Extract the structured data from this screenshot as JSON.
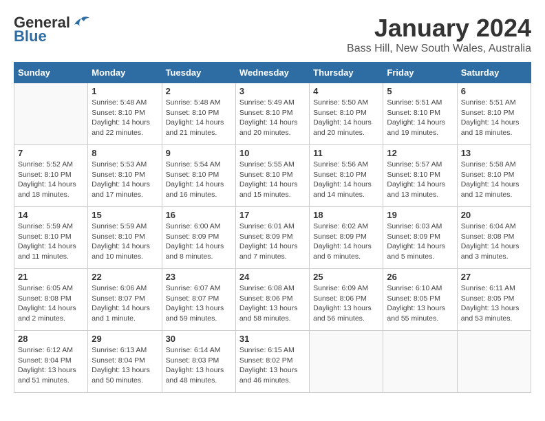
{
  "logo": {
    "general": "General",
    "blue": "Blue"
  },
  "title": "January 2024",
  "location": "Bass Hill, New South Wales, Australia",
  "days_of_week": [
    "Sunday",
    "Monday",
    "Tuesday",
    "Wednesday",
    "Thursday",
    "Friday",
    "Saturday"
  ],
  "weeks": [
    [
      {
        "day": "",
        "detail": ""
      },
      {
        "day": "1",
        "detail": "Sunrise: 5:48 AM\nSunset: 8:10 PM\nDaylight: 14 hours\nand 22 minutes."
      },
      {
        "day": "2",
        "detail": "Sunrise: 5:48 AM\nSunset: 8:10 PM\nDaylight: 14 hours\nand 21 minutes."
      },
      {
        "day": "3",
        "detail": "Sunrise: 5:49 AM\nSunset: 8:10 PM\nDaylight: 14 hours\nand 20 minutes."
      },
      {
        "day": "4",
        "detail": "Sunrise: 5:50 AM\nSunset: 8:10 PM\nDaylight: 14 hours\nand 20 minutes."
      },
      {
        "day": "5",
        "detail": "Sunrise: 5:51 AM\nSunset: 8:10 PM\nDaylight: 14 hours\nand 19 minutes."
      },
      {
        "day": "6",
        "detail": "Sunrise: 5:51 AM\nSunset: 8:10 PM\nDaylight: 14 hours\nand 18 minutes."
      }
    ],
    [
      {
        "day": "7",
        "detail": "Sunrise: 5:52 AM\nSunset: 8:10 PM\nDaylight: 14 hours\nand 18 minutes."
      },
      {
        "day": "8",
        "detail": "Sunrise: 5:53 AM\nSunset: 8:10 PM\nDaylight: 14 hours\nand 17 minutes."
      },
      {
        "day": "9",
        "detail": "Sunrise: 5:54 AM\nSunset: 8:10 PM\nDaylight: 14 hours\nand 16 minutes."
      },
      {
        "day": "10",
        "detail": "Sunrise: 5:55 AM\nSunset: 8:10 PM\nDaylight: 14 hours\nand 15 minutes."
      },
      {
        "day": "11",
        "detail": "Sunrise: 5:56 AM\nSunset: 8:10 PM\nDaylight: 14 hours\nand 14 minutes."
      },
      {
        "day": "12",
        "detail": "Sunrise: 5:57 AM\nSunset: 8:10 PM\nDaylight: 14 hours\nand 13 minutes."
      },
      {
        "day": "13",
        "detail": "Sunrise: 5:58 AM\nSunset: 8:10 PM\nDaylight: 14 hours\nand 12 minutes."
      }
    ],
    [
      {
        "day": "14",
        "detail": "Sunrise: 5:59 AM\nSunset: 8:10 PM\nDaylight: 14 hours\nand 11 minutes."
      },
      {
        "day": "15",
        "detail": "Sunrise: 5:59 AM\nSunset: 8:10 PM\nDaylight: 14 hours\nand 10 minutes."
      },
      {
        "day": "16",
        "detail": "Sunrise: 6:00 AM\nSunset: 8:09 PM\nDaylight: 14 hours\nand 8 minutes."
      },
      {
        "day": "17",
        "detail": "Sunrise: 6:01 AM\nSunset: 8:09 PM\nDaylight: 14 hours\nand 7 minutes."
      },
      {
        "day": "18",
        "detail": "Sunrise: 6:02 AM\nSunset: 8:09 PM\nDaylight: 14 hours\nand 6 minutes."
      },
      {
        "day": "19",
        "detail": "Sunrise: 6:03 AM\nSunset: 8:09 PM\nDaylight: 14 hours\nand 5 minutes."
      },
      {
        "day": "20",
        "detail": "Sunrise: 6:04 AM\nSunset: 8:08 PM\nDaylight: 14 hours\nand 3 minutes."
      }
    ],
    [
      {
        "day": "21",
        "detail": "Sunrise: 6:05 AM\nSunset: 8:08 PM\nDaylight: 14 hours\nand 2 minutes."
      },
      {
        "day": "22",
        "detail": "Sunrise: 6:06 AM\nSunset: 8:07 PM\nDaylight: 14 hours\nand 1 minute."
      },
      {
        "day": "23",
        "detail": "Sunrise: 6:07 AM\nSunset: 8:07 PM\nDaylight: 13 hours\nand 59 minutes."
      },
      {
        "day": "24",
        "detail": "Sunrise: 6:08 AM\nSunset: 8:06 PM\nDaylight: 13 hours\nand 58 minutes."
      },
      {
        "day": "25",
        "detail": "Sunrise: 6:09 AM\nSunset: 8:06 PM\nDaylight: 13 hours\nand 56 minutes."
      },
      {
        "day": "26",
        "detail": "Sunrise: 6:10 AM\nSunset: 8:05 PM\nDaylight: 13 hours\nand 55 minutes."
      },
      {
        "day": "27",
        "detail": "Sunrise: 6:11 AM\nSunset: 8:05 PM\nDaylight: 13 hours\nand 53 minutes."
      }
    ],
    [
      {
        "day": "28",
        "detail": "Sunrise: 6:12 AM\nSunset: 8:04 PM\nDaylight: 13 hours\nand 51 minutes."
      },
      {
        "day": "29",
        "detail": "Sunrise: 6:13 AM\nSunset: 8:04 PM\nDaylight: 13 hours\nand 50 minutes."
      },
      {
        "day": "30",
        "detail": "Sunrise: 6:14 AM\nSunset: 8:03 PM\nDaylight: 13 hours\nand 48 minutes."
      },
      {
        "day": "31",
        "detail": "Sunrise: 6:15 AM\nSunset: 8:02 PM\nDaylight: 13 hours\nand 46 minutes."
      },
      {
        "day": "",
        "detail": ""
      },
      {
        "day": "",
        "detail": ""
      },
      {
        "day": "",
        "detail": ""
      }
    ]
  ]
}
